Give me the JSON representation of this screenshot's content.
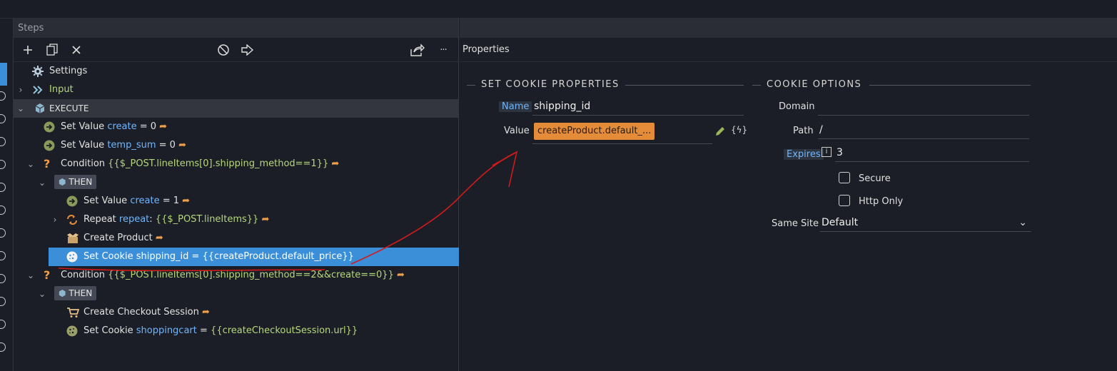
{
  "steps_panel": {
    "title": "Steps",
    "toolbar": {
      "add_icon": "plus-icon",
      "copy_icon": "copy-icon",
      "delete_icon": "close-icon",
      "disable_icon": "disable-icon",
      "export_icon": "export-icon",
      "share_icon": "share-icon",
      "more_label": "···"
    },
    "tree": {
      "settings": "Settings",
      "input": "Input",
      "execute": "EXECUTE",
      "set_value_1": {
        "prefix": "Set Value ",
        "name": "create",
        "rest": " = 0"
      },
      "set_value_2": {
        "prefix": "Set Value ",
        "name": "temp_sum",
        "rest": " = 0"
      },
      "condition_1": {
        "prefix": "Condition ",
        "expr": "{{$_POST.lineItems[0].shipping_method==1}}"
      },
      "then_1": "THEN",
      "set_value_3": {
        "prefix": "Set Value ",
        "name": "create",
        "rest": " = 1"
      },
      "repeat": {
        "prefix": "Repeat ",
        "name": "repeat",
        "colon": ": ",
        "expr": "{{$_POST.lineItems}}"
      },
      "create_product": "Create Product",
      "set_cookie_1": "Set Cookie shipping_id = {{createProduct.default_price}}",
      "condition_2": {
        "prefix": "Condition ",
        "expr": "{{$_POST.lineItems[0].shipping_method==2&&create==0}}"
      },
      "then_2": "THEN",
      "create_checkout": "Create Checkout Session",
      "set_cookie_2": {
        "prefix": "Set Cookie ",
        "name": "shoppingcart",
        "rest": " = ",
        "expr": "{{createCheckoutSession.url}}"
      }
    }
  },
  "properties_panel": {
    "title": "Properties",
    "set_cookie_section": "SET COOKIE PROPERTIES",
    "cookie_options_section": "COOKIE OPTIONS",
    "name_label": "Name",
    "name_value": "shipping_id",
    "value_label": "Value",
    "value_value": "createProduct.default_...",
    "dynamic_label": "{ϟ}",
    "domain_label": "Domain",
    "domain_value": "",
    "path_label": "Path",
    "path_value": "/",
    "expires_label": "Expires",
    "expires_value": "3",
    "secure_label": "Secure",
    "secure_checked": false,
    "httponly_label": "Http Only",
    "httponly_checked": false,
    "samesite_label": "Same Site",
    "samesite_value": "Default"
  },
  "colors": {
    "accent": "#3b8fd9",
    "value_pill": "#e58c3b",
    "annotation": "#d11a1a"
  }
}
